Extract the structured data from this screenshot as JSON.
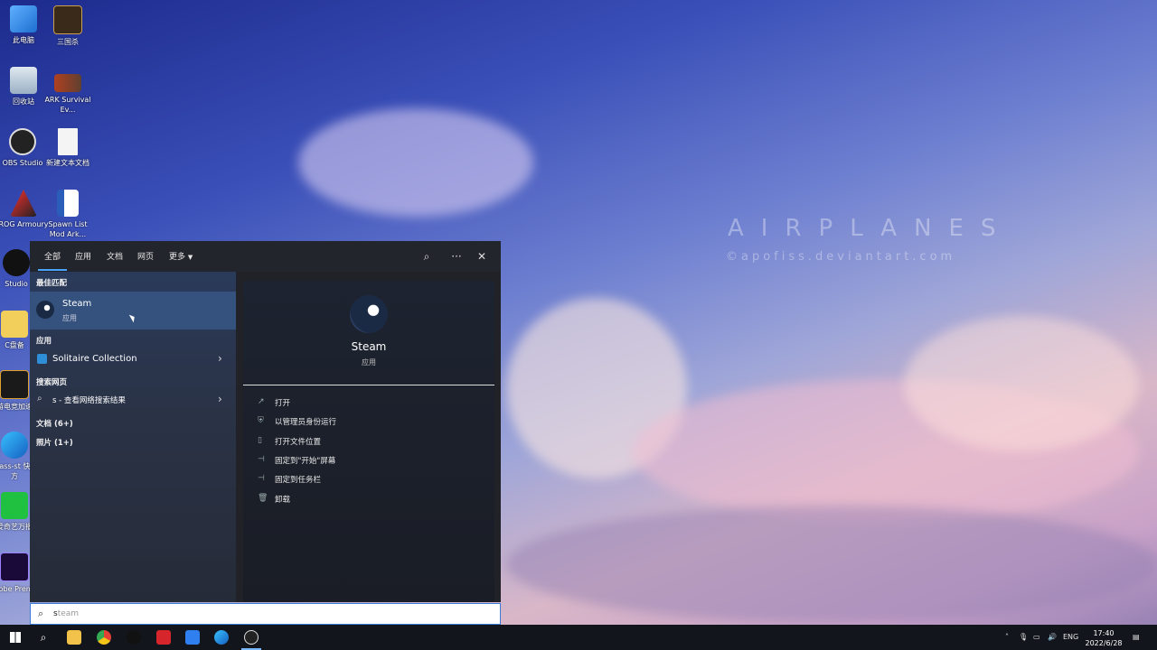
{
  "wallpaper": {
    "title": "AIRPLANES",
    "credit": "©apofiss.deviantart.com"
  },
  "desktop_icons": [
    {
      "label": "此电脑"
    },
    {
      "label": "三国杀"
    },
    {
      "label": "回收站"
    },
    {
      "label": "ARK Survival Ev..."
    },
    {
      "label": "OBS Studio"
    },
    {
      "label": "新建文本文档"
    },
    {
      "label": "ROG Armoury"
    },
    {
      "label": "Spawn List Mod Ark..."
    },
    {
      "label": "Studio"
    },
    {
      "label": "C盘备"
    },
    {
      "label": "奇游电竞加速器"
    },
    {
      "label": "ccass-st 快捷方"
    },
    {
      "label": "爱奇艺万播"
    },
    {
      "label": "Adobe Premie"
    }
  ],
  "search": {
    "tabs": [
      "全部",
      "应用",
      "文档",
      "网页",
      "更多"
    ],
    "sections": {
      "best_match": "最佳匹配",
      "apps": "应用",
      "web": "搜索网页",
      "docs": "文档 (6+)",
      "photos": "照片 (1+)"
    },
    "best_item": {
      "name": "Steam",
      "type": "应用"
    },
    "app_item": {
      "name": "Solitaire Collection"
    },
    "web_item": {
      "text": "s - 查看网络搜索结果"
    },
    "detail": {
      "name": "Steam",
      "type": "应用"
    },
    "actions": [
      "打开",
      "以管理员身份运行",
      "打开文件位置",
      "固定到\"开始\"屏幕",
      "固定到任务栏",
      "卸载"
    ],
    "query_typed": "s",
    "query_ghost": "team"
  },
  "taskbar": {
    "lang": "ENG",
    "time": "17:40",
    "date": "2022/6/28"
  },
  "colors": {
    "accent": "#4aa3ff",
    "best_match_bg": "#35527e",
    "panel_bg": "#202228",
    "taskbar_bg": "#13151c"
  }
}
